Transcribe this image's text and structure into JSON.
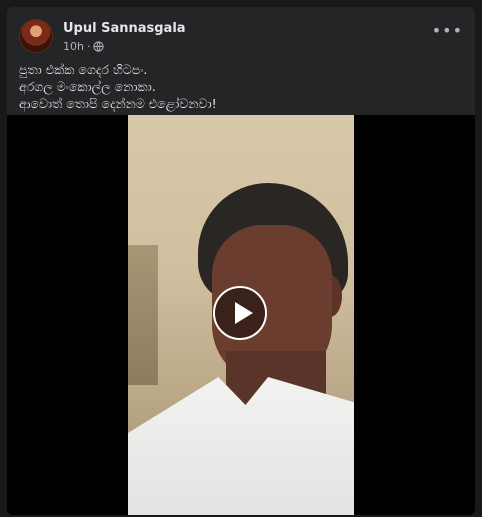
{
  "post": {
    "author": "Upul Sannasgala",
    "time": "10h",
    "privacy_icon": "globe-icon",
    "more_label": "•••",
    "caption_lines": [
      "පුතා එක්ක ගෙදර හිටපං.",
      "අරගල මංකොල්ල නොකා.",
      "ආවොත් තොපි දෙන්නම එළෝවනවා!"
    ]
  },
  "video": {
    "play_icon": "play-icon"
  },
  "colors": {
    "background": "#18191a",
    "card": "#242526",
    "text_primary": "#e4e6eb",
    "text_secondary": "#b0b3b8"
  }
}
